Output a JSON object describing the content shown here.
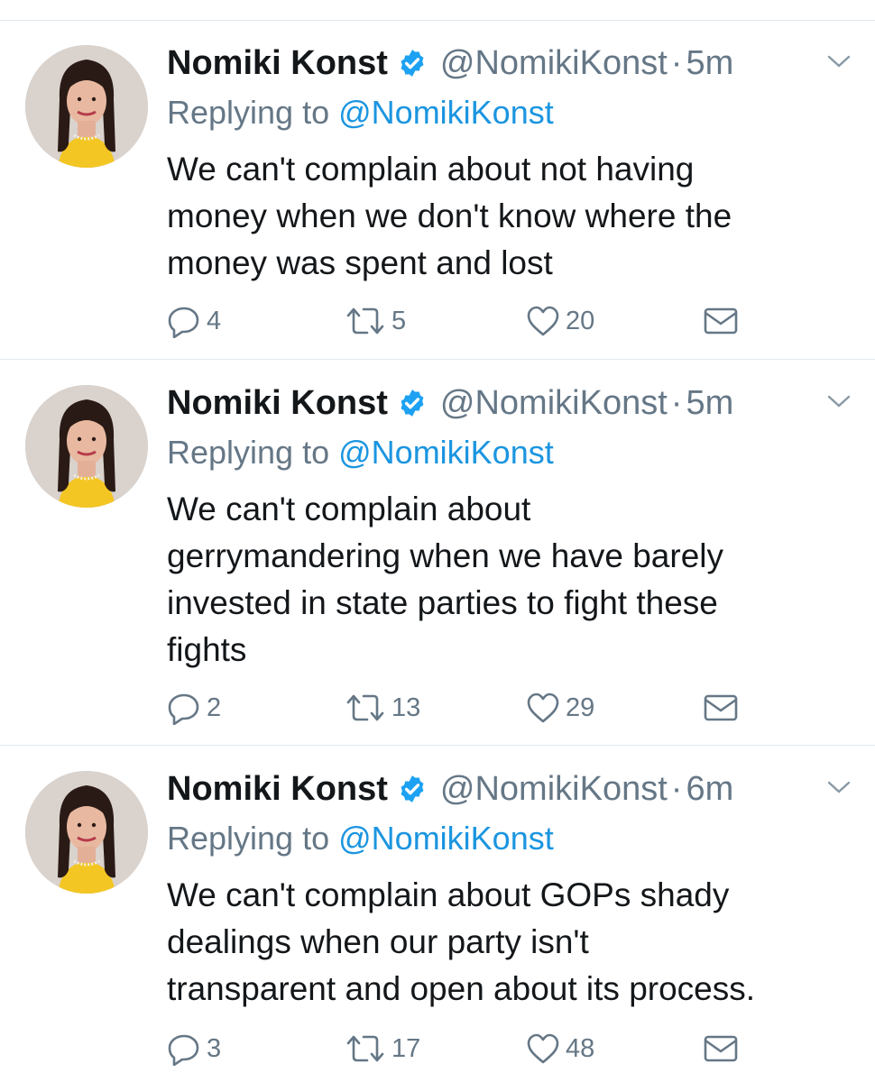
{
  "colors": {
    "text": "#14171a",
    "secondary": "#657786",
    "link": "#1b95e0",
    "verified": "#1da1f2",
    "divider": "#e1e8ed"
  },
  "tweets": [
    {
      "name": "Nomiki Konst",
      "handle": "@NomikiKonst",
      "separator": "·",
      "time": "5m",
      "replying_prefix": "Replying to",
      "replying_handle": "@NomikiKonst",
      "lines": [
        "We can't complain about not having",
        "money when we don't know where the",
        "money was spent and lost"
      ],
      "replies": "4",
      "retweets": "5",
      "likes": "20",
      "icons": [
        "reply-icon",
        "retweet-icon",
        "like-icon",
        "message-icon"
      ]
    },
    {
      "name": "Nomiki Konst",
      "handle": "@NomikiKonst",
      "separator": "·",
      "time": "5m",
      "replying_prefix": "Replying to",
      "replying_handle": "@NomikiKonst",
      "lines": [
        "We can't complain about",
        "gerrymandering when we have barely",
        "invested in state parties to fight these",
        "fights"
      ],
      "replies": "2",
      "retweets": "13",
      "likes": "29",
      "icons": [
        "reply-icon",
        "retweet-icon",
        "like-icon",
        "message-icon"
      ]
    },
    {
      "name": "Nomiki Konst",
      "handle": "@NomikiKonst",
      "separator": "·",
      "time": "6m",
      "replying_prefix": "Replying to",
      "replying_handle": "@NomikiKonst",
      "lines": [
        "We can't complain about GOPs shady",
        "dealings when our party isn't",
        "transparent and open about its process."
      ],
      "replies": "3",
      "retweets": "17",
      "likes": "48",
      "icons": [
        "reply-icon",
        "retweet-icon",
        "like-icon",
        "message-icon"
      ]
    }
  ]
}
